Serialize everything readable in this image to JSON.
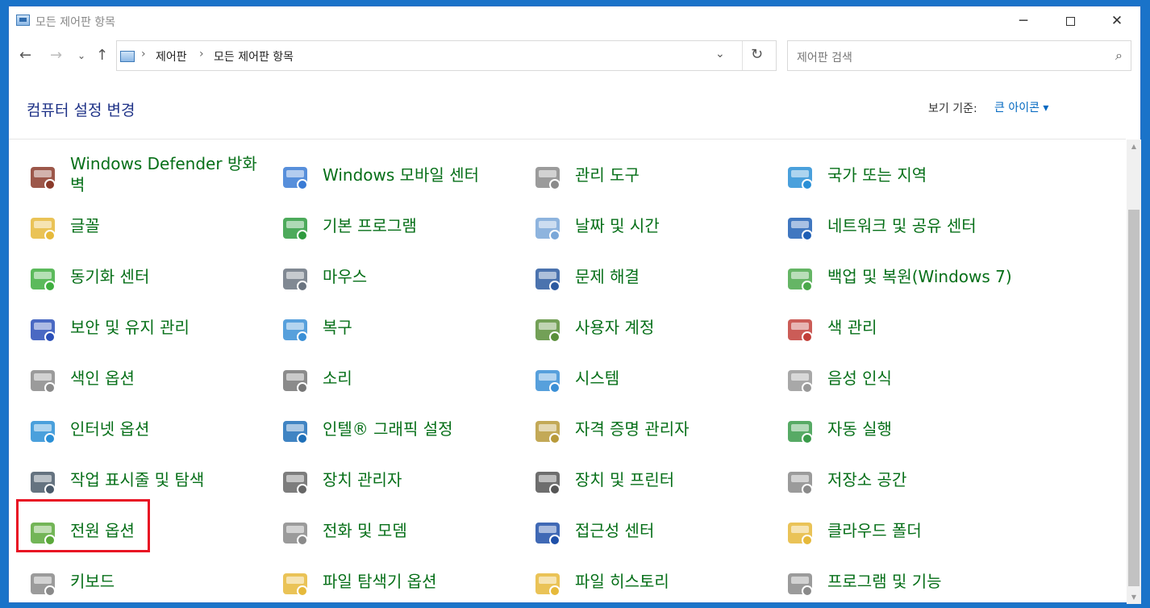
{
  "window": {
    "title": "모든 제어판 항목",
    "minimize": "─",
    "close": "✕"
  },
  "nav": {
    "back": "←",
    "forward": "→",
    "recent": "⌄",
    "up": "↑",
    "breadcrumb": [
      "제어판",
      "모든 제어판 항목"
    ],
    "separator": "›",
    "dropdown": "⌄",
    "refresh": "↻"
  },
  "search": {
    "placeholder": "제어판 검색"
  },
  "header": {
    "title": "컴퓨터 설정 변경",
    "view_by_label": "보기 기준:",
    "view_by_value": "큰 아이콘 ▾"
  },
  "items": [
    {
      "label": "Windows Defender 방화벽",
      "icon": "firewall-icon",
      "color": "#8b3a2a"
    },
    {
      "label": "Windows 모바일 센터",
      "icon": "mobility-center-icon",
      "color": "#3a7bd5"
    },
    {
      "label": "관리 도구",
      "icon": "admin-tools-icon",
      "color": "#8a8a8a"
    },
    {
      "label": "국가 또는 지역",
      "icon": "region-globe-icon",
      "color": "#2a8fd6"
    },
    {
      "label": "글꼴",
      "icon": "fonts-icon",
      "color": "#e6b93a"
    },
    {
      "label": "기본 프로그램",
      "icon": "default-programs-icon",
      "color": "#2e9b3e"
    },
    {
      "label": "날짜 및 시간",
      "icon": "date-time-icon",
      "color": "#7aa7d8"
    },
    {
      "label": "네트워크 및 공유 센터",
      "icon": "network-icon",
      "color": "#1f5fb5"
    },
    {
      "label": "동기화 센터",
      "icon": "sync-center-icon",
      "color": "#3fae3f"
    },
    {
      "label": "마우스",
      "icon": "mouse-icon",
      "color": "#6b7480"
    },
    {
      "label": "문제 해결",
      "icon": "troubleshooting-icon",
      "color": "#2c5aa0"
    },
    {
      "label": "백업 및 복원(Windows 7)",
      "icon": "backup-restore-icon",
      "color": "#4aa84a"
    },
    {
      "label": "보안 및 유지 관리",
      "icon": "security-flag-icon",
      "color": "#2a4fb8"
    },
    {
      "label": "복구",
      "icon": "recovery-icon",
      "color": "#3a8fd6"
    },
    {
      "label": "사용자 계정",
      "icon": "user-accounts-icon",
      "color": "#5a8f3a"
    },
    {
      "label": "색 관리",
      "icon": "color-management-icon",
      "color": "#c2403a"
    },
    {
      "label": "색인 옵션",
      "icon": "indexing-icon",
      "color": "#8a8a8a"
    },
    {
      "label": "소리",
      "icon": "sound-speaker-icon",
      "color": "#777777"
    },
    {
      "label": "시스템",
      "icon": "system-icon",
      "color": "#3a8fd6"
    },
    {
      "label": "음성 인식",
      "icon": "microphone-icon",
      "color": "#999999"
    },
    {
      "label": "인터넷 옵션",
      "icon": "internet-options-icon",
      "color": "#2a8fd6"
    },
    {
      "label": "인텔® 그래픽 설정",
      "icon": "intel-graphics-icon",
      "color": "#1e6fb8"
    },
    {
      "label": "자격 증명 관리자",
      "icon": "credential-manager-icon",
      "color": "#b89a3a"
    },
    {
      "label": "자동 실행",
      "icon": "autoplay-icon",
      "color": "#3a9b4a"
    },
    {
      "label": "작업 표시줄 및 탐색",
      "icon": "taskbar-icon",
      "color": "#4a5a6a"
    },
    {
      "label": "장치 관리자",
      "icon": "device-manager-icon",
      "color": "#666666"
    },
    {
      "label": "장치 및 프린터",
      "icon": "devices-printers-icon",
      "color": "#555555"
    },
    {
      "label": "저장소 공간",
      "icon": "storage-spaces-icon",
      "color": "#8a8a8a"
    },
    {
      "label": "전원 옵션",
      "icon": "power-options-icon",
      "color": "#5aa83a"
    },
    {
      "label": "전화 및 모뎀",
      "icon": "phone-modem-icon",
      "color": "#8a8a8a"
    },
    {
      "label": "접근성 센터",
      "icon": "ease-of-access-icon",
      "color": "#1e4fa8"
    },
    {
      "label": "클라우드 폴더",
      "icon": "work-folders-icon",
      "color": "#e6b93a"
    },
    {
      "label": "키보드",
      "icon": "keyboard-icon",
      "color": "#8a8a8a"
    },
    {
      "label": "파일 탐색기 옵션",
      "icon": "file-explorer-options-icon",
      "color": "#e6b93a"
    },
    {
      "label": "파일 히스토리",
      "icon": "file-history-icon",
      "color": "#e6b93a"
    },
    {
      "label": "프로그램 및 기능",
      "icon": "programs-features-icon",
      "color": "#8a8a8a"
    }
  ]
}
